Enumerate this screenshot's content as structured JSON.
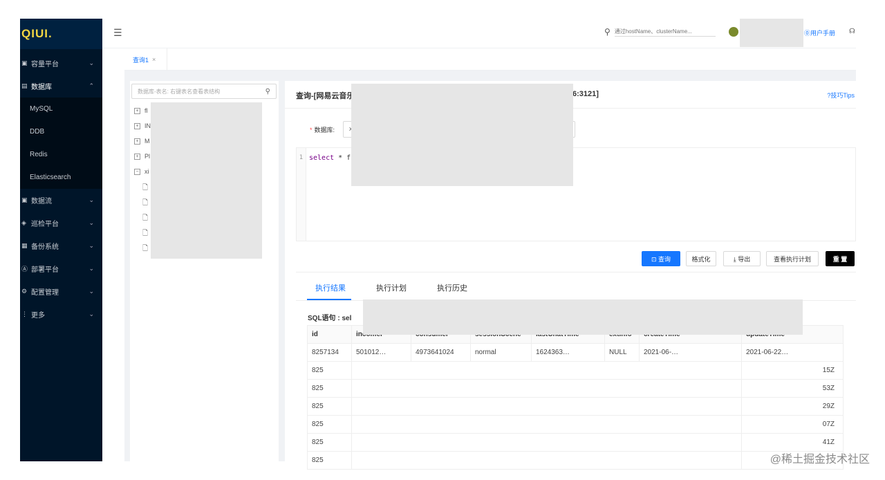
{
  "sidebar": {
    "logo": "QIUI.",
    "items": [
      {
        "label": "容量平台",
        "icon": "grid-icon",
        "expanded": false
      },
      {
        "label": "数据库",
        "icon": "database-icon",
        "expanded": true
      },
      {
        "label": "数据流",
        "icon": "flow-icon",
        "expanded": false
      },
      {
        "label": "巡检平台",
        "icon": "inspect-icon",
        "expanded": false
      },
      {
        "label": "备份系统",
        "icon": "backup-icon",
        "expanded": false
      },
      {
        "label": "部署平台",
        "icon": "deploy-icon",
        "expanded": false
      },
      {
        "label": "配置管理",
        "icon": "gear-icon",
        "expanded": false
      },
      {
        "label": "更多",
        "icon": "more-icon",
        "expanded": false
      }
    ],
    "sub_items": [
      "MySQL",
      "DDB",
      "Redis",
      "Elasticsearch"
    ]
  },
  "topbar": {
    "search_placeholder": "通过hostName、clusterName...",
    "help_label": "⓪用户手册"
  },
  "tabs": [
    {
      "label": "查询1",
      "close": "×"
    }
  ],
  "tree": {
    "search_placeholder": "数据库-表名: 右键表名查看表结构",
    "nodes": [
      {
        "toggle": "+",
        "label": "fl"
      },
      {
        "toggle": "+",
        "label": "IN"
      },
      {
        "toggle": "+",
        "label": "M"
      },
      {
        "toggle": "+",
        "label": "Pl"
      },
      {
        "toggle": "−",
        "label": "xi"
      }
    ],
    "leaf_count": 5
  },
  "query": {
    "title_start": "查询-[网易云音乐",
    "title_end": "6:3121]",
    "tips_label": "?技巧Tips",
    "db_label": "数据库:",
    "db_value": "x",
    "editor_line": "1",
    "editor_code_kw": "select",
    "editor_code_op": " * fr"
  },
  "buttons": {
    "query": "⊡ 查询",
    "format": "格式化",
    "export": "⤓ 导出",
    "explain": "查看执行计划",
    "reset": "重 置"
  },
  "results": {
    "tabs": [
      "执行结果",
      "执行计划",
      "执行历史"
    ],
    "sql_label": "SQL语句 : sel",
    "columns": [
      "id",
      "incomer",
      "consumer",
      "sessionScene",
      "lastChatTime",
      "extInfo",
      "createTime",
      "updateTime"
    ],
    "first_row": [
      "8257134",
      "501012…",
      "4973641024",
      "normal",
      "1624363…",
      "NULL",
      "2021-06-…",
      "2021-06-22…"
    ],
    "rows": [
      {
        "id": "825",
        "tail": "15Z"
      },
      {
        "id": "825",
        "tail": "53Z"
      },
      {
        "id": "825",
        "tail": "29Z"
      },
      {
        "id": "825",
        "tail": "07Z"
      },
      {
        "id": "825",
        "tail": "41Z"
      },
      {
        "id": "825",
        "tail": ""
      }
    ]
  },
  "watermark": "@稀土掘金技术社区",
  "colors": {
    "sidebar_bg": "#001529",
    "accent": "#1677ff",
    "dark_button": "#000000"
  }
}
